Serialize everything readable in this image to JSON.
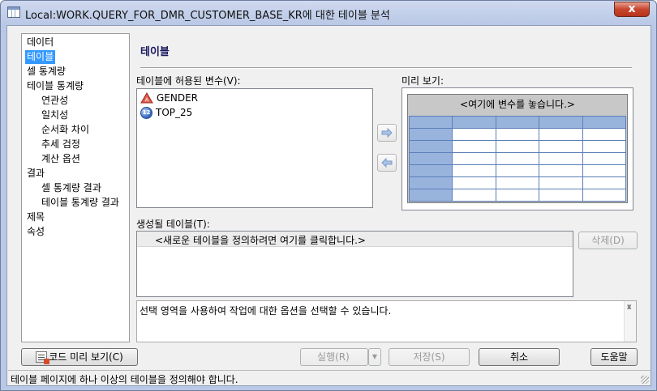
{
  "window": {
    "title": "Local:WORK.QUERY_FOR_DMR_CUSTOMER_BASE_KR에 대한 테이블 분석",
    "close_glyph": "x"
  },
  "nav": {
    "items": [
      {
        "label": "데이터",
        "selected": false,
        "indent": 0
      },
      {
        "label": "테이블",
        "selected": true,
        "indent": 0
      },
      {
        "label": "셀 통계량",
        "selected": false,
        "indent": 0
      },
      {
        "label": "테이블 통계량",
        "selected": false,
        "indent": 0
      },
      {
        "label": "연관성",
        "selected": false,
        "indent": 1
      },
      {
        "label": "일치성",
        "selected": false,
        "indent": 1
      },
      {
        "label": "순서화 차이",
        "selected": false,
        "indent": 1
      },
      {
        "label": "추세 검정",
        "selected": false,
        "indent": 1
      },
      {
        "label": "계산 옵션",
        "selected": false,
        "indent": 1
      },
      {
        "label": "결과",
        "selected": false,
        "indent": 0
      },
      {
        "label": "셀 통계량 결과",
        "selected": false,
        "indent": 1
      },
      {
        "label": "테이블 통계량 결과",
        "selected": false,
        "indent": 1
      },
      {
        "label": "제목",
        "selected": false,
        "indent": 0
      },
      {
        "label": "속성",
        "selected": false,
        "indent": 0
      }
    ]
  },
  "main": {
    "section_title": "테이블",
    "variables_label": "테이블에 허용된 변수(V):",
    "variables": [
      {
        "name": "GENDER",
        "icon": "character-variable-icon"
      },
      {
        "name": "TOP_25",
        "icon": "numeric-variable-icon"
      }
    ],
    "preview_label": "미리 보기:",
    "preview_placeholder": "<여기에 변수를 놓습니다.>",
    "tables_label": "생성될 테이블(T):",
    "tables_placeholder": "<새로운 테이블을 정의하려면 여기를 클릭합니다.>",
    "delete_button": "삭제(D)",
    "description": "선택 영역을 사용하여 작업에 대한 옵션을 선택할 수 있습니다."
  },
  "buttons": {
    "preview_code": "코드 미리 보기(C)",
    "run": "실행(R)",
    "save": "저장(S)",
    "cancel": "취소",
    "help": "도움말"
  },
  "status": {
    "message": "테이블 페이지에 하나 이상의 테이블을 정의해야 합니다."
  },
  "colors": {
    "selection": "#3399ff",
    "grid_header": "#98b4dd",
    "title_bar": "#b9c8e6"
  }
}
